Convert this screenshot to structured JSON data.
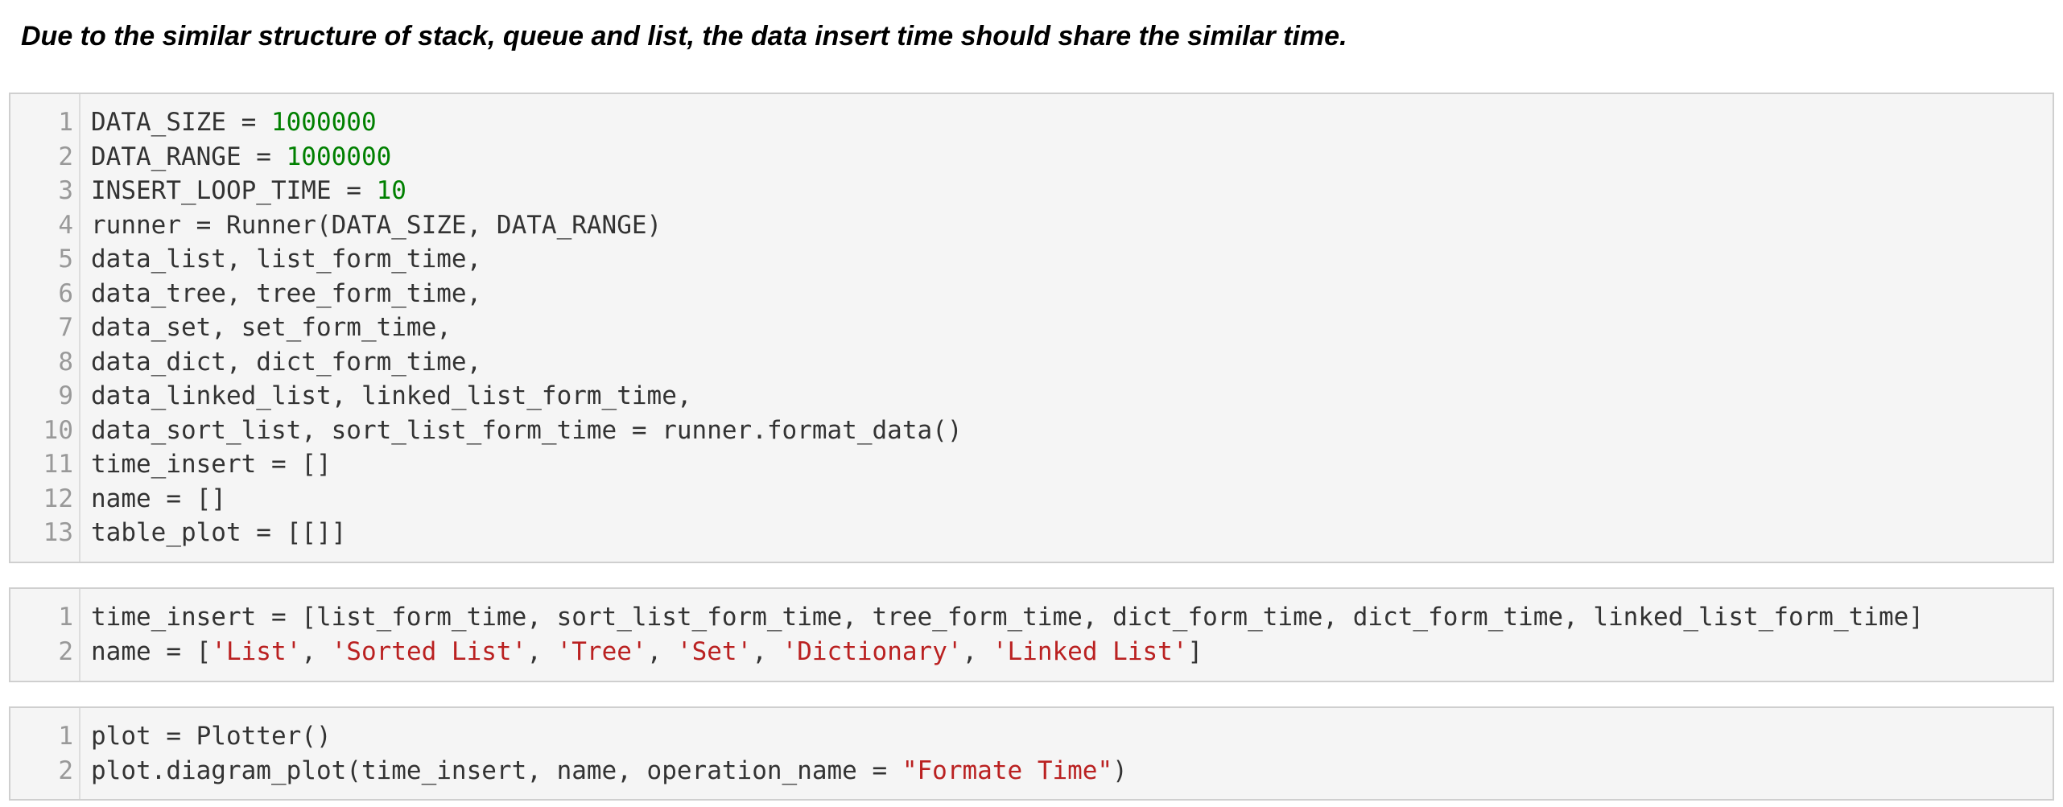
{
  "heading": "Due to the similar structure of stack, queue and list, the data insert time should share the similar time.",
  "colors": {
    "cell_background": "#f5f5f5",
    "cell_border": "#cfcfcf",
    "number": "#008000",
    "string": "#ba2121",
    "text": "#333333",
    "line_number": "#999999"
  },
  "cells": [
    {
      "lines": [
        {
          "n": "1",
          "parts": [
            {
              "t": "DATA_SIZE = ",
              "c": ""
            },
            {
              "t": "1000000",
              "c": "num"
            }
          ]
        },
        {
          "n": "2",
          "parts": [
            {
              "t": "DATA_RANGE = ",
              "c": ""
            },
            {
              "t": "1000000",
              "c": "num"
            }
          ]
        },
        {
          "n": "3",
          "parts": [
            {
              "t": "INSERT_LOOP_TIME = ",
              "c": ""
            },
            {
              "t": "10",
              "c": "num"
            }
          ]
        },
        {
          "n": "4",
          "parts": [
            {
              "t": "runner = Runner(DATA_SIZE, DATA_RANGE)",
              "c": ""
            }
          ]
        },
        {
          "n": "5",
          "parts": [
            {
              "t": "data_list, list_form_time,",
              "c": ""
            }
          ]
        },
        {
          "n": "6",
          "parts": [
            {
              "t": "data_tree, tree_form_time,",
              "c": ""
            }
          ]
        },
        {
          "n": "7",
          "parts": [
            {
              "t": "data_set, set_form_time,",
              "c": ""
            }
          ]
        },
        {
          "n": "8",
          "parts": [
            {
              "t": "data_dict, dict_form_time,",
              "c": ""
            }
          ]
        },
        {
          "n": "9",
          "parts": [
            {
              "t": "data_linked_list, linked_list_form_time,",
              "c": ""
            }
          ]
        },
        {
          "n": "10",
          "parts": [
            {
              "t": "data_sort_list, sort_list_form_time = runner.format_data()",
              "c": ""
            }
          ]
        },
        {
          "n": "11",
          "parts": [
            {
              "t": "time_insert = []",
              "c": ""
            }
          ]
        },
        {
          "n": "12",
          "parts": [
            {
              "t": "name = []",
              "c": ""
            }
          ]
        },
        {
          "n": "13",
          "parts": [
            {
              "t": "table_plot = [[]]",
              "c": ""
            }
          ]
        }
      ]
    },
    {
      "lines": [
        {
          "n": "1",
          "parts": [
            {
              "t": "time_insert = [list_form_time, sort_list_form_time, tree_form_time, dict_form_time, dict_form_time, linked_list_form_time]",
              "c": ""
            }
          ]
        },
        {
          "n": "2",
          "parts": [
            {
              "t": "name = [",
              "c": ""
            },
            {
              "t": "'List'",
              "c": "str"
            },
            {
              "t": ", ",
              "c": ""
            },
            {
              "t": "'Sorted List'",
              "c": "str"
            },
            {
              "t": ", ",
              "c": ""
            },
            {
              "t": "'Tree'",
              "c": "str"
            },
            {
              "t": ", ",
              "c": ""
            },
            {
              "t": "'Set'",
              "c": "str"
            },
            {
              "t": ", ",
              "c": ""
            },
            {
              "t": "'Dictionary'",
              "c": "str"
            },
            {
              "t": ", ",
              "c": ""
            },
            {
              "t": "'Linked List'",
              "c": "str"
            },
            {
              "t": "]",
              "c": ""
            }
          ]
        }
      ]
    },
    {
      "lines": [
        {
          "n": "1",
          "parts": [
            {
              "t": "plot = Plotter()",
              "c": ""
            }
          ]
        },
        {
          "n": "2",
          "parts": [
            {
              "t": "plot.diagram_plot(time_insert, name, operation_name = ",
              "c": ""
            },
            {
              "t": "\"Formate Time\"",
              "c": "str"
            },
            {
              "t": ")",
              "c": ""
            }
          ]
        }
      ]
    }
  ]
}
